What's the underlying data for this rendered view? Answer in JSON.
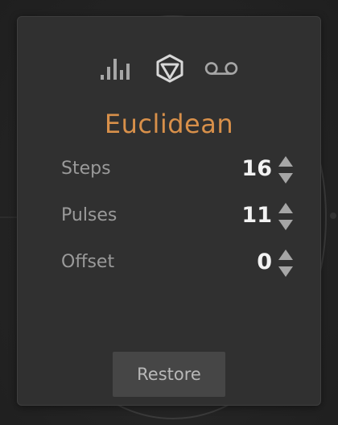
{
  "tabs": [
    {
      "icon": "bar-chart-icon",
      "active": false
    },
    {
      "icon": "polygon-icon",
      "active": true
    },
    {
      "icon": "voicemail-icon",
      "active": false
    }
  ],
  "title": "Euclidean",
  "params": [
    {
      "label": "Steps",
      "value": "16"
    },
    {
      "label": "Pulses",
      "value": "11"
    },
    {
      "label": "Offset",
      "value": "0"
    }
  ],
  "restore_label": "Restore",
  "colors": {
    "accent": "#d8904a",
    "panel": "#303030",
    "label": "#9a9a9a",
    "value": "#f2f2f2",
    "icon": "#a6a6a6",
    "icon_active": "#d8d8d8"
  }
}
